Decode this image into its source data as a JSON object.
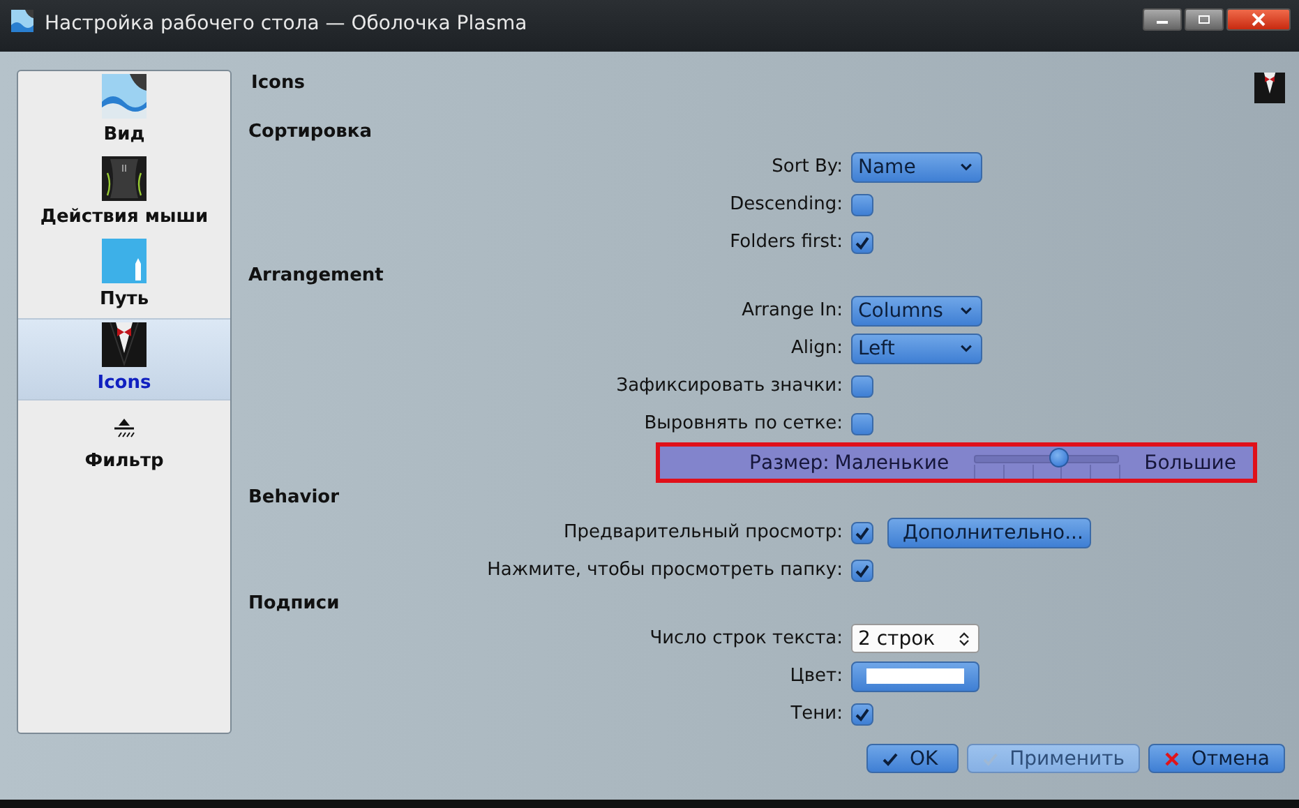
{
  "window": {
    "title": "Настройка рабочего стола — Оболочка Plasma"
  },
  "sidebar": {
    "items": [
      {
        "label": "Вид",
        "kind": "view",
        "selected": false
      },
      {
        "label": "Действия мыши",
        "kind": "mouse",
        "selected": false
      },
      {
        "label": "Путь",
        "kind": "path",
        "selected": false
      },
      {
        "label": "Icons",
        "kind": "tux",
        "selected": true
      },
      {
        "label": "Фильтр",
        "kind": "filter",
        "selected": false
      }
    ]
  },
  "page": {
    "title": "Icons"
  },
  "sections": [
    {
      "title": "Сортировка",
      "rows": [
        {
          "kind": "combo",
          "label": "Sort By:",
          "value": "Name"
        },
        {
          "kind": "checkbox",
          "label": "Descending:",
          "checked": false
        },
        {
          "kind": "checkbox",
          "label": "Folders first:",
          "checked": true
        }
      ]
    },
    {
      "title": "Arrangement",
      "rows": [
        {
          "kind": "combo",
          "label": "Arrange In:",
          "value": "Columns"
        },
        {
          "kind": "combo",
          "label": "Align:",
          "value": "Left"
        },
        {
          "kind": "checkbox",
          "label": "Зафиксировать значки:",
          "checked": false
        },
        {
          "kind": "checkbox",
          "label": "Выровнять по сетке:",
          "checked": false
        },
        {
          "kind": "slider",
          "label": "Размер:",
          "min_label": "Маленькие",
          "max_label": "Большие",
          "level": 0.59,
          "highlighted": true
        }
      ]
    },
    {
      "title": "Behavior",
      "rows": [
        {
          "kind": "checkbox",
          "label": "Предварительный просмотр:",
          "checked": true,
          "button": "Дополнительно..."
        },
        {
          "kind": "checkbox",
          "label": "Нажмите, чтобы просмотреть папку:",
          "checked": true
        }
      ]
    },
    {
      "title": "Подписи",
      "rows": [
        {
          "kind": "spin",
          "label": "Число строк текста:",
          "value": "2 строк"
        },
        {
          "kind": "color",
          "label": "Цвет:",
          "color": "#ffffff"
        },
        {
          "kind": "checkbox",
          "label": "Тени:",
          "checked": true
        }
      ]
    }
  ],
  "buttons": [
    {
      "label": "OK",
      "kind": "check",
      "disabled": false
    },
    {
      "label": "Применить",
      "kind": "check",
      "disabled": true
    },
    {
      "label": "Отмена",
      "kind": "cross",
      "disabled": false
    }
  ]
}
